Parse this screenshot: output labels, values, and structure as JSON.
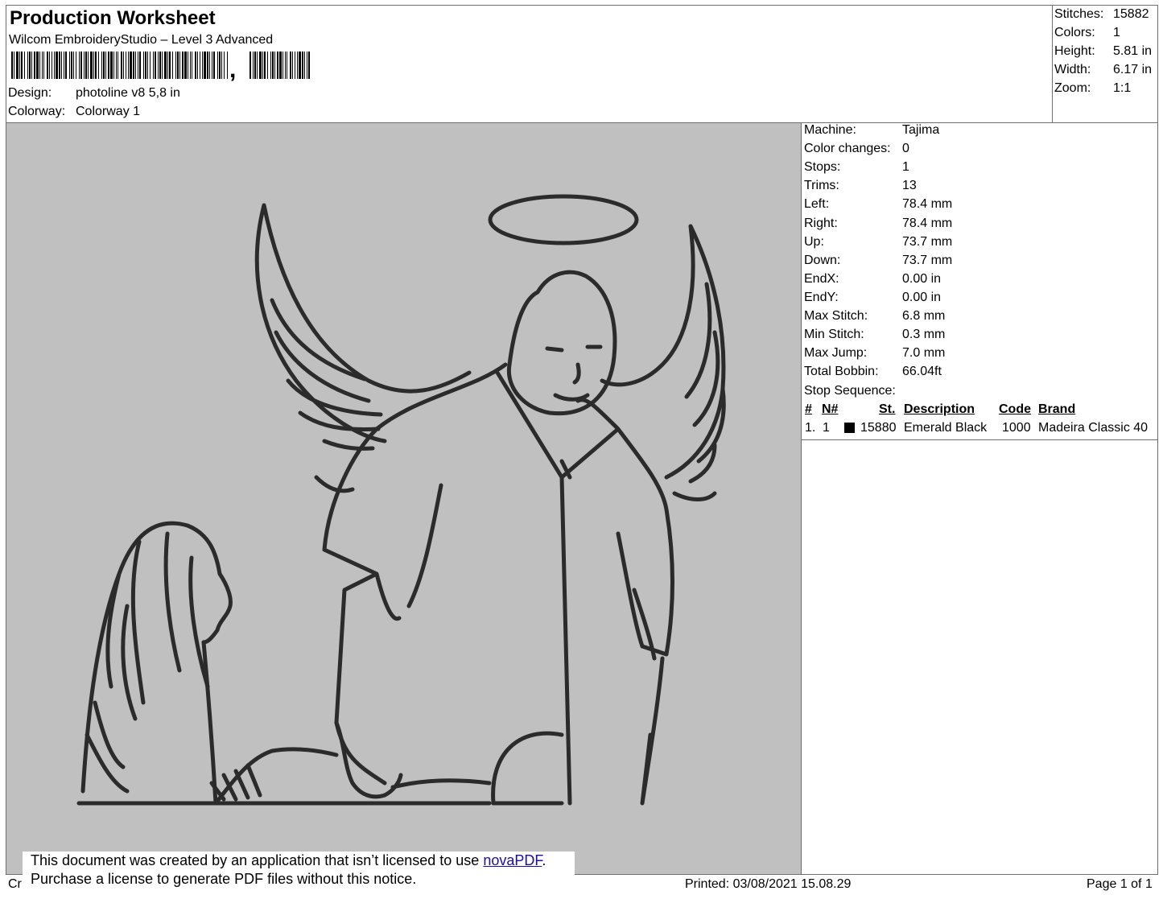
{
  "header": {
    "title": "Production Worksheet",
    "software": "Wilcom EmbroideryStudio – Level 3 Advanced",
    "barcode_suffix": ",",
    "design_label": "Design:",
    "design_value": "photoline v8 5,8 in",
    "colorway_label": "Colorway:",
    "colorway_value": "Colorway 1"
  },
  "stats": [
    {
      "label": "Stitches:",
      "value": "15882"
    },
    {
      "label": "Colors:",
      "value": "1"
    },
    {
      "label": "Height:",
      "value": "5.81 in"
    },
    {
      "label": "Width:",
      "value": "6.17 in"
    },
    {
      "label": "Zoom:",
      "value": "1:1"
    }
  ],
  "specs": [
    {
      "label": "Machine:",
      "value": "Tajima"
    },
    {
      "label": "Color changes:",
      "value": "0"
    },
    {
      "label": "Stops:",
      "value": "1"
    },
    {
      "label": "Trims:",
      "value": "13"
    },
    {
      "label": "Left:",
      "value": "78.4 mm"
    },
    {
      "label": "Right:",
      "value": "78.4 mm"
    },
    {
      "label": "Up:",
      "value": "73.7 mm"
    },
    {
      "label": "Down:",
      "value": "73.7 mm"
    },
    {
      "label": "EndX:",
      "value": "0.00 in"
    },
    {
      "label": "EndY:",
      "value": "0.00 in"
    },
    {
      "label": "Max Stitch:",
      "value": "6.8 mm"
    },
    {
      "label": "Min Stitch:",
      "value": "0.3 mm"
    },
    {
      "label": "Max Jump:",
      "value": "7.0 mm"
    },
    {
      "label": "Total Bobbin:",
      "value": "66.04ft"
    }
  ],
  "stop_sequence": {
    "title": "Stop Sequence:",
    "columns": [
      "#",
      "N#",
      "St.",
      "Description",
      "Code",
      "Brand"
    ],
    "rows": [
      {
        "index": "1.",
        "needle": "1",
        "color": "#000000",
        "stitches": "15880",
        "description": "Emerald Black",
        "code": "1000",
        "brand": "Madeira Classic 40"
      }
    ]
  },
  "colors": {
    "canvas_bg": "#c0c0c0",
    "thread": "#2b2b2b",
    "border": "#6e6e6e"
  },
  "notice": {
    "line1_prefix": "This document was created by an application that isn’t licensed to use ",
    "link_text": "novaPDF",
    "line1_suffix": ".",
    "line2": "Purchase a license to generate PDF files without this notice."
  },
  "footer": {
    "left_fragment": "Cr",
    "printed": "Printed: 03/08/2021 15.08.29",
    "page": "Page 1 of 1"
  }
}
